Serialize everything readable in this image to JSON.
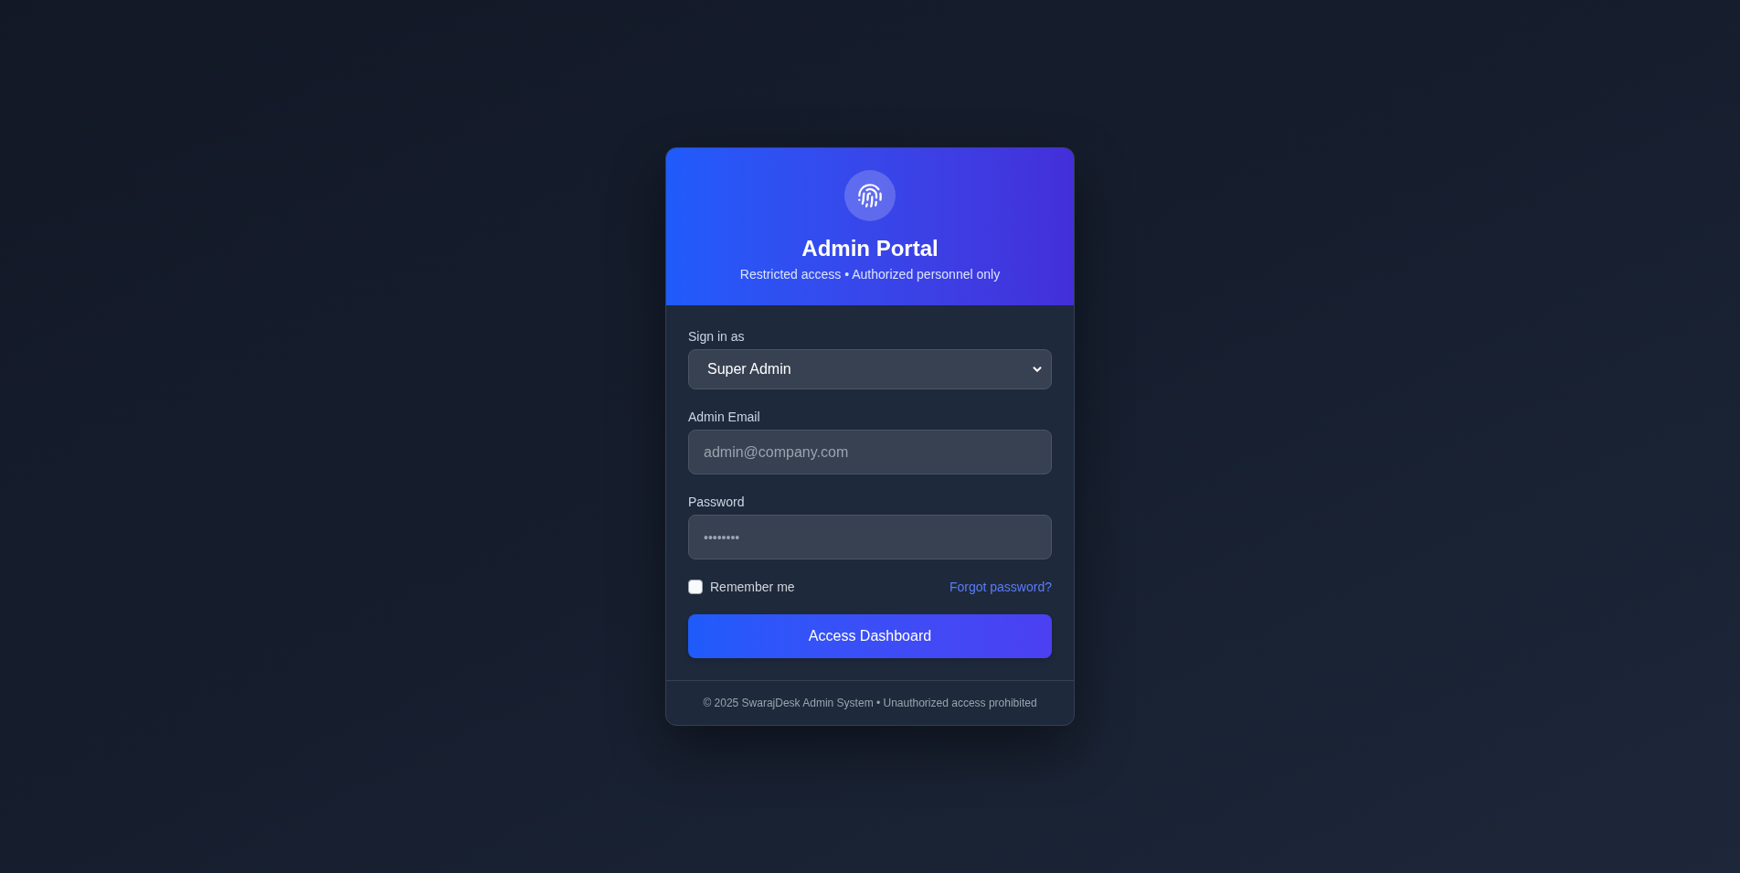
{
  "header": {
    "title": "Admin Portal",
    "subtitle": "Restricted access • Authorized personnel only"
  },
  "form": {
    "role": {
      "label": "Sign in as",
      "value": "Super Admin"
    },
    "email": {
      "label": "Admin Email",
      "placeholder": "admin@company.com"
    },
    "password": {
      "label": "Password",
      "placeholder": "••••••••"
    },
    "remember": {
      "label": "Remember me",
      "checked": false
    },
    "forgot_link": "Forgot password?",
    "submit": "Access Dashboard"
  },
  "footer": "© 2025 SwarajDesk Admin System • Unauthorized access prohibited"
}
